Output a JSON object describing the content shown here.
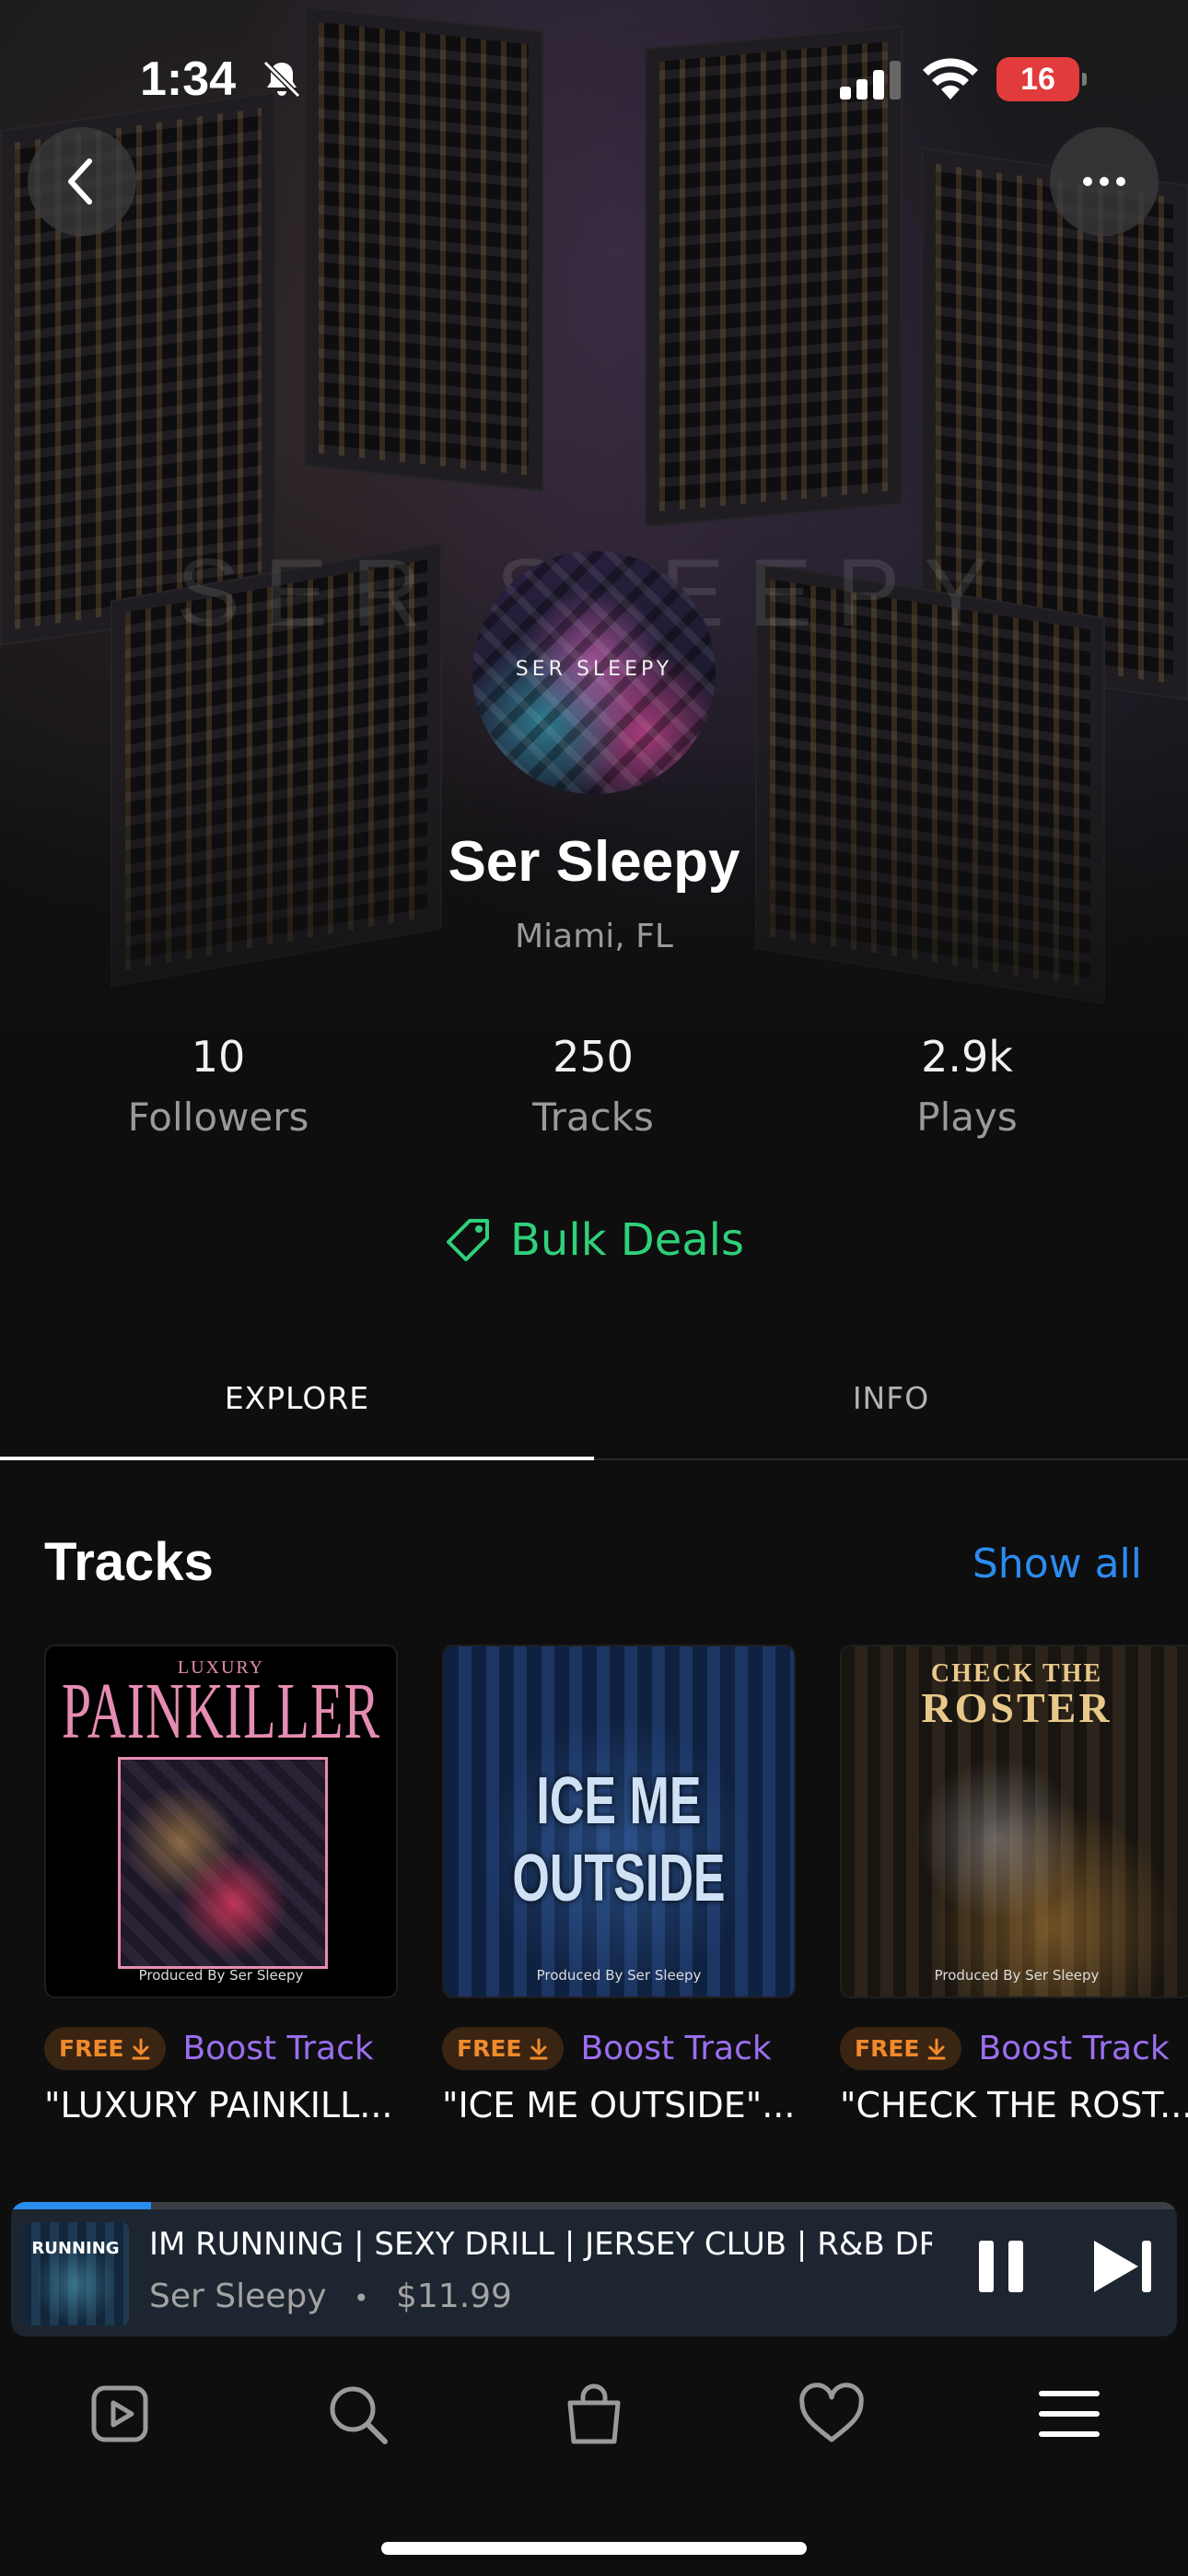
{
  "status": {
    "time": "1:34",
    "battery": "16"
  },
  "hero": {
    "watermark": "SER SLEEPY",
    "avatar_text": "SER SLEEPY"
  },
  "artist": {
    "name": "Ser Sleepy",
    "location": "Miami, FL"
  },
  "stats": [
    {
      "value": "10",
      "label": "Followers"
    },
    {
      "value": "250",
      "label": "Tracks"
    },
    {
      "value": "2.9k",
      "label": "Plays"
    }
  ],
  "bulk_deals": "Bulk Deals",
  "tabs": {
    "explore": "EXPLORE",
    "info": "INFO",
    "active": "explore"
  },
  "tracks_section": {
    "title": "Tracks",
    "show_all": "Show all"
  },
  "tracks": [
    {
      "cover_line1": "LUXURY",
      "cover_line2": "PAINKILLER",
      "cover_credit": "Produced By Ser Sleepy",
      "badge": "FREE",
      "boost": "Boost Track",
      "title": "\"LUXURY PAINKILL..."
    },
    {
      "cover_line1": "",
      "cover_line2": "ICE ME OUTSIDE",
      "cover_credit": "Produced By Ser Sleepy",
      "badge": "FREE",
      "boost": "Boost Track",
      "title": "\"ICE ME OUTSIDE\"..."
    },
    {
      "cover_line1": "CHECK THE",
      "cover_line2": "ROSTER",
      "cover_credit": "Produced By Ser Sleepy",
      "badge": "FREE",
      "boost": "Boost Track",
      "title": "\"CHECK THE ROST..."
    }
  ],
  "player": {
    "art_text": "RUNNING",
    "title": "IM RUNNING | SEXY DRILL | JERSEY CLUB | R&B DR...",
    "artist": "Ser Sleepy",
    "separator": "•",
    "price": "$11.99",
    "progress": 0.12
  },
  "colors": {
    "accent_green": "#2fd07a",
    "accent_blue": "#2b8cf0",
    "boost_purple": "#9b6ff0",
    "free_orange": "#f08a2c",
    "battery_red": "#e23b3b"
  },
  "icons": [
    "back-chevron-icon",
    "more-dots-icon",
    "tag-icon",
    "download-arrow-icon",
    "pause-icon",
    "skip-next-icon",
    "play-square-icon",
    "search-icon",
    "shopping-bag-icon",
    "heart-icon",
    "menu-icon"
  ]
}
